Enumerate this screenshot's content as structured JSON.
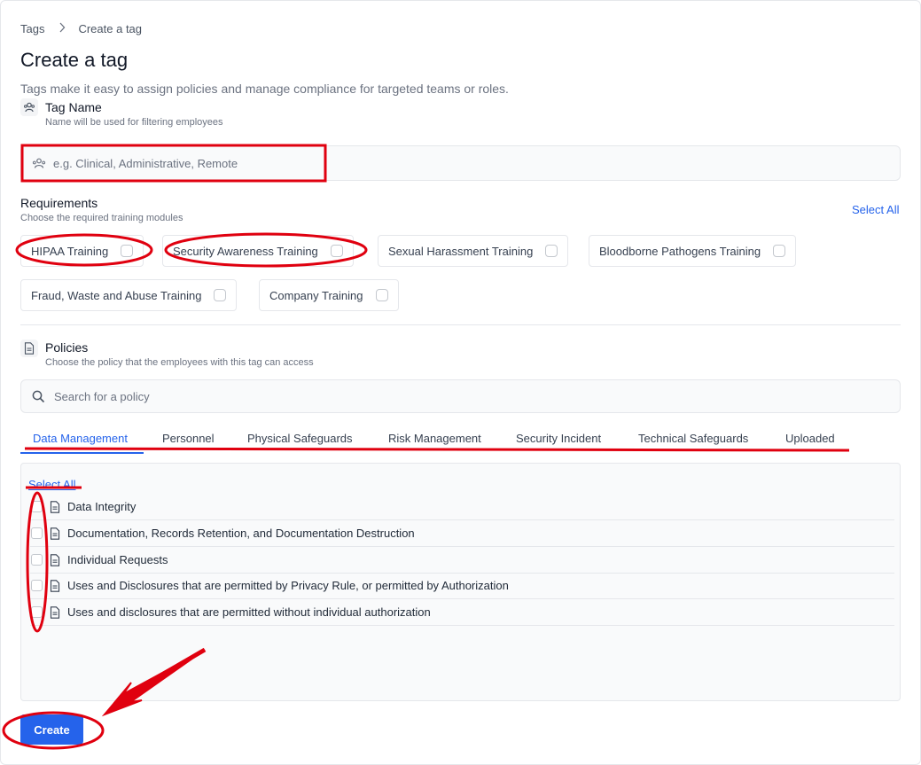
{
  "breadcrumb": {
    "parent": "Tags",
    "current": "Create a tag"
  },
  "page": {
    "title": "Create a tag",
    "subtitle": "Tags make it easy to assign policies and manage compliance for targeted teams or roles."
  },
  "tag_name": {
    "title": "Tag Name",
    "description": "Name will be used for filtering employees",
    "placeholder": "e.g. Clinical, Administrative, Remote"
  },
  "requirements": {
    "title": "Requirements",
    "description": "Choose the required training modules",
    "select_all": "Select All",
    "modules": [
      {
        "label": "HIPAA Training",
        "checked": false
      },
      {
        "label": "Security Awareness Training",
        "checked": false
      },
      {
        "label": "Sexual Harassment Training",
        "checked": false
      },
      {
        "label": "Bloodborne Pathogens Training",
        "checked": false
      },
      {
        "label": "Fraud, Waste and Abuse Training",
        "checked": false
      },
      {
        "label": "Company Training",
        "checked": false
      }
    ]
  },
  "policies": {
    "title": "Policies",
    "description": "Choose the policy that the employees with this tag can access",
    "search_placeholder": "Search for a policy",
    "tabs": [
      {
        "label": "Data Management",
        "active": true
      },
      {
        "label": "Personnel",
        "active": false
      },
      {
        "label": "Physical Safeguards",
        "active": false
      },
      {
        "label": "Risk Management",
        "active": false
      },
      {
        "label": "Security Incident",
        "active": false
      },
      {
        "label": "Technical Safeguards",
        "active": false
      },
      {
        "label": "Uploaded",
        "active": false
      }
    ],
    "select_all": "Select All",
    "items": [
      {
        "label": "Data Integrity",
        "checked": false
      },
      {
        "label": "Documentation, Records Retention, and Documentation Destruction",
        "checked": false
      },
      {
        "label": "Individual Requests",
        "checked": false
      },
      {
        "label": "Uses and Disclosures that are permitted by Privacy Rule, or permitted by Authorization",
        "checked": false
      },
      {
        "label": "Uses and disclosures that are permitted without individual authorization",
        "checked": false
      }
    ]
  },
  "actions": {
    "create": "Create"
  },
  "colors": {
    "accent": "#2563eb",
    "annotation": "#e0000f"
  }
}
